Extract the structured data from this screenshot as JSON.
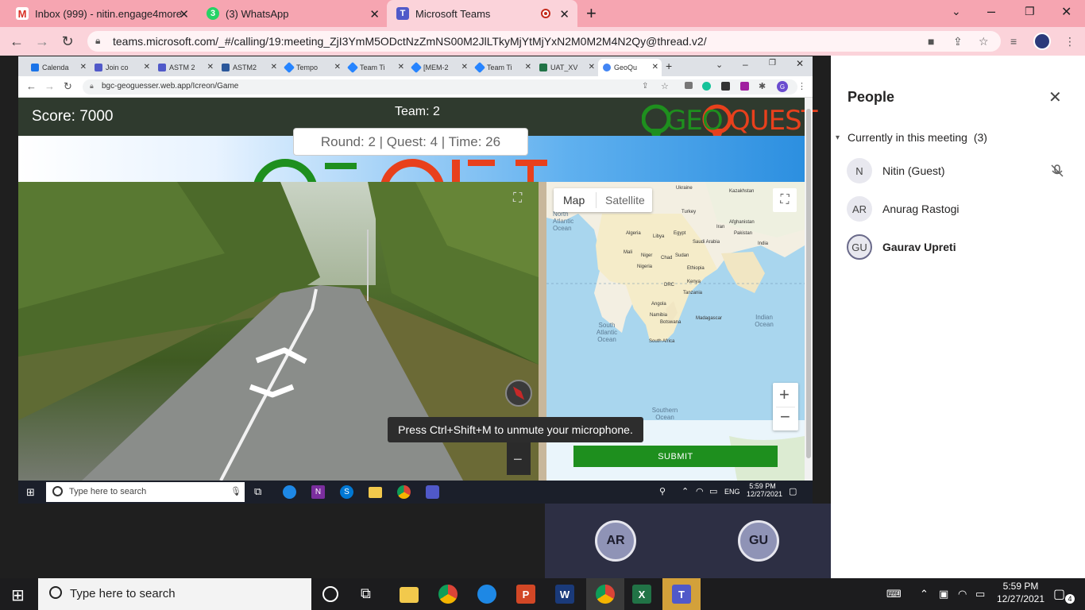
{
  "chrome": {
    "tabs": [
      {
        "label": "Inbox (999) - nitin.engage4more",
        "close": "✕"
      },
      {
        "label": "(3) WhatsApp",
        "close": "✕"
      },
      {
        "label": "Microsoft Teams",
        "close": "✕"
      }
    ],
    "new_tab": "+",
    "url": "teams.microsoft.com/_#/calling/19:meeting_ZjI3YmM5ODctNzZmNS00M2JlLTkyMjYtMjYxN2M0M2M4N2Qy@thread.v2/"
  },
  "shared_screen": {
    "tabs": [
      "Calenda",
      "Join co",
      "ASTM 2",
      "ASTM2",
      "Tempo",
      "Team Ti",
      "[MEM-2",
      "Team Ti",
      "UAT_XV",
      "GeoQu"
    ],
    "url": "bgc-geoguesser.web.app/Icreon/Game",
    "game": {
      "score": "Score: 7000",
      "team": "Team: 2",
      "round_info": "Round: 2 | Quest: 4 | Time: 26",
      "logo_geo": "GEO",
      "logo_quest": "QUEST",
      "map_toggle_map": "Map",
      "map_toggle_satellite": "Satellite",
      "submit": "SUBMIT",
      "zoom_in": "+",
      "zoom_out": "−",
      "map_labels": [
        {
          "text": "North Atlantic Ocean"
        },
        {
          "text": "South Atlantic Ocean"
        },
        {
          "text": "Indian Ocean"
        },
        {
          "text": "Southern Ocean"
        },
        {
          "text": "Algeria"
        },
        {
          "text": "Libya"
        },
        {
          "text": "Egypt"
        },
        {
          "text": "Mali"
        },
        {
          "text": "Niger"
        },
        {
          "text": "Chad"
        },
        {
          "text": "Sudan"
        },
        {
          "text": "Nigeria"
        },
        {
          "text": "Ethiopia"
        },
        {
          "text": "DRC"
        },
        {
          "text": "Kenya"
        },
        {
          "text": "Tanzania"
        },
        {
          "text": "Angola"
        },
        {
          "text": "Namibia"
        },
        {
          "text": "Botswana"
        },
        {
          "text": "Madagascar"
        },
        {
          "text": "South Africa"
        },
        {
          "text": "Turkey"
        },
        {
          "text": "Iran"
        },
        {
          "text": "Saudi Arabia"
        },
        {
          "text": "Afghanistan"
        },
        {
          "text": "Pakistan"
        },
        {
          "text": "India"
        },
        {
          "text": "Kazakhstan"
        },
        {
          "text": "Ukraine"
        }
      ]
    },
    "toast": "Press Ctrl+Shift+M to unmute your microphone.",
    "taskbar": {
      "search_placeholder": "Type here to search",
      "time": "5:59 PM",
      "date": "12/27/2021",
      "lang": "ENG"
    }
  },
  "call": {
    "avatars": [
      "AR",
      "GU"
    ]
  },
  "people_panel": {
    "title": "People",
    "section": "Currently in this meeting",
    "count": "(3)",
    "participants": [
      {
        "initials": "N",
        "name": "Nitin (Guest)",
        "muted": true
      },
      {
        "initials": "AR",
        "name": "Anurag Rastogi"
      },
      {
        "initials": "GU",
        "name": "Gaurav Upreti",
        "bold": true
      }
    ]
  },
  "windows_taskbar": {
    "search_placeholder": "Type here to search",
    "time": "5:59 PM",
    "date": "12/27/2021",
    "notification_count": "4"
  }
}
